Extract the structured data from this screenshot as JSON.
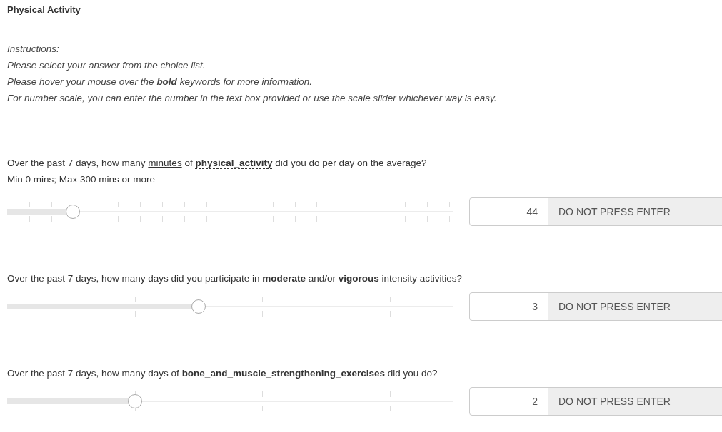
{
  "title": "Physical Activity",
  "instructions": [
    "Instructions:",
    "Please select your answer from the choice list.",
    "Please hover your mouse over the **bold** keywords for more information.",
    "For number scale, you can enter the number in the text box provided or use the scale slider whichever way is easy."
  ],
  "questions": [
    {
      "segments": [
        {
          "kind": "plain",
          "text": "Over the past 7 days, how many "
        },
        {
          "kind": "underlined",
          "text": "minutes"
        },
        {
          "kind": "plain",
          "text": " of "
        },
        {
          "kind": "keyword",
          "text": "physical_activity"
        },
        {
          "kind": "plain",
          "text": " did you do per day on the average?"
        }
      ],
      "hint": "Min 0 mins; Max 300 mins or more",
      "kind": "fine",
      "level": 0.147,
      "value": "44",
      "button": "DO NOT PRESS ENTER"
    },
    {
      "segments": [
        {
          "kind": "plain",
          "text": "Over the past 7 days, how many days did you participate in "
        },
        {
          "kind": "keyword",
          "text": "moderate"
        },
        {
          "kind": "plain",
          "text": " and/or "
        },
        {
          "kind": "keyword",
          "text": "vigorous"
        },
        {
          "kind": "plain",
          "text": " intensity activities?"
        }
      ],
      "kind": "coarse",
      "level": 0.4286,
      "value": "3",
      "button": "DO NOT PRESS ENTER"
    },
    {
      "segments": [
        {
          "kind": "plain",
          "text": "Over the past 7 days, how many days of "
        },
        {
          "kind": "keyword",
          "text": "bone_and_muscle_strengthening_exercises"
        },
        {
          "kind": "plain",
          "text": " did you do?"
        }
      ],
      "kind": "coarse",
      "level": 0.2857,
      "value": "2",
      "button": "DO NOT PRESS ENTER"
    }
  ]
}
